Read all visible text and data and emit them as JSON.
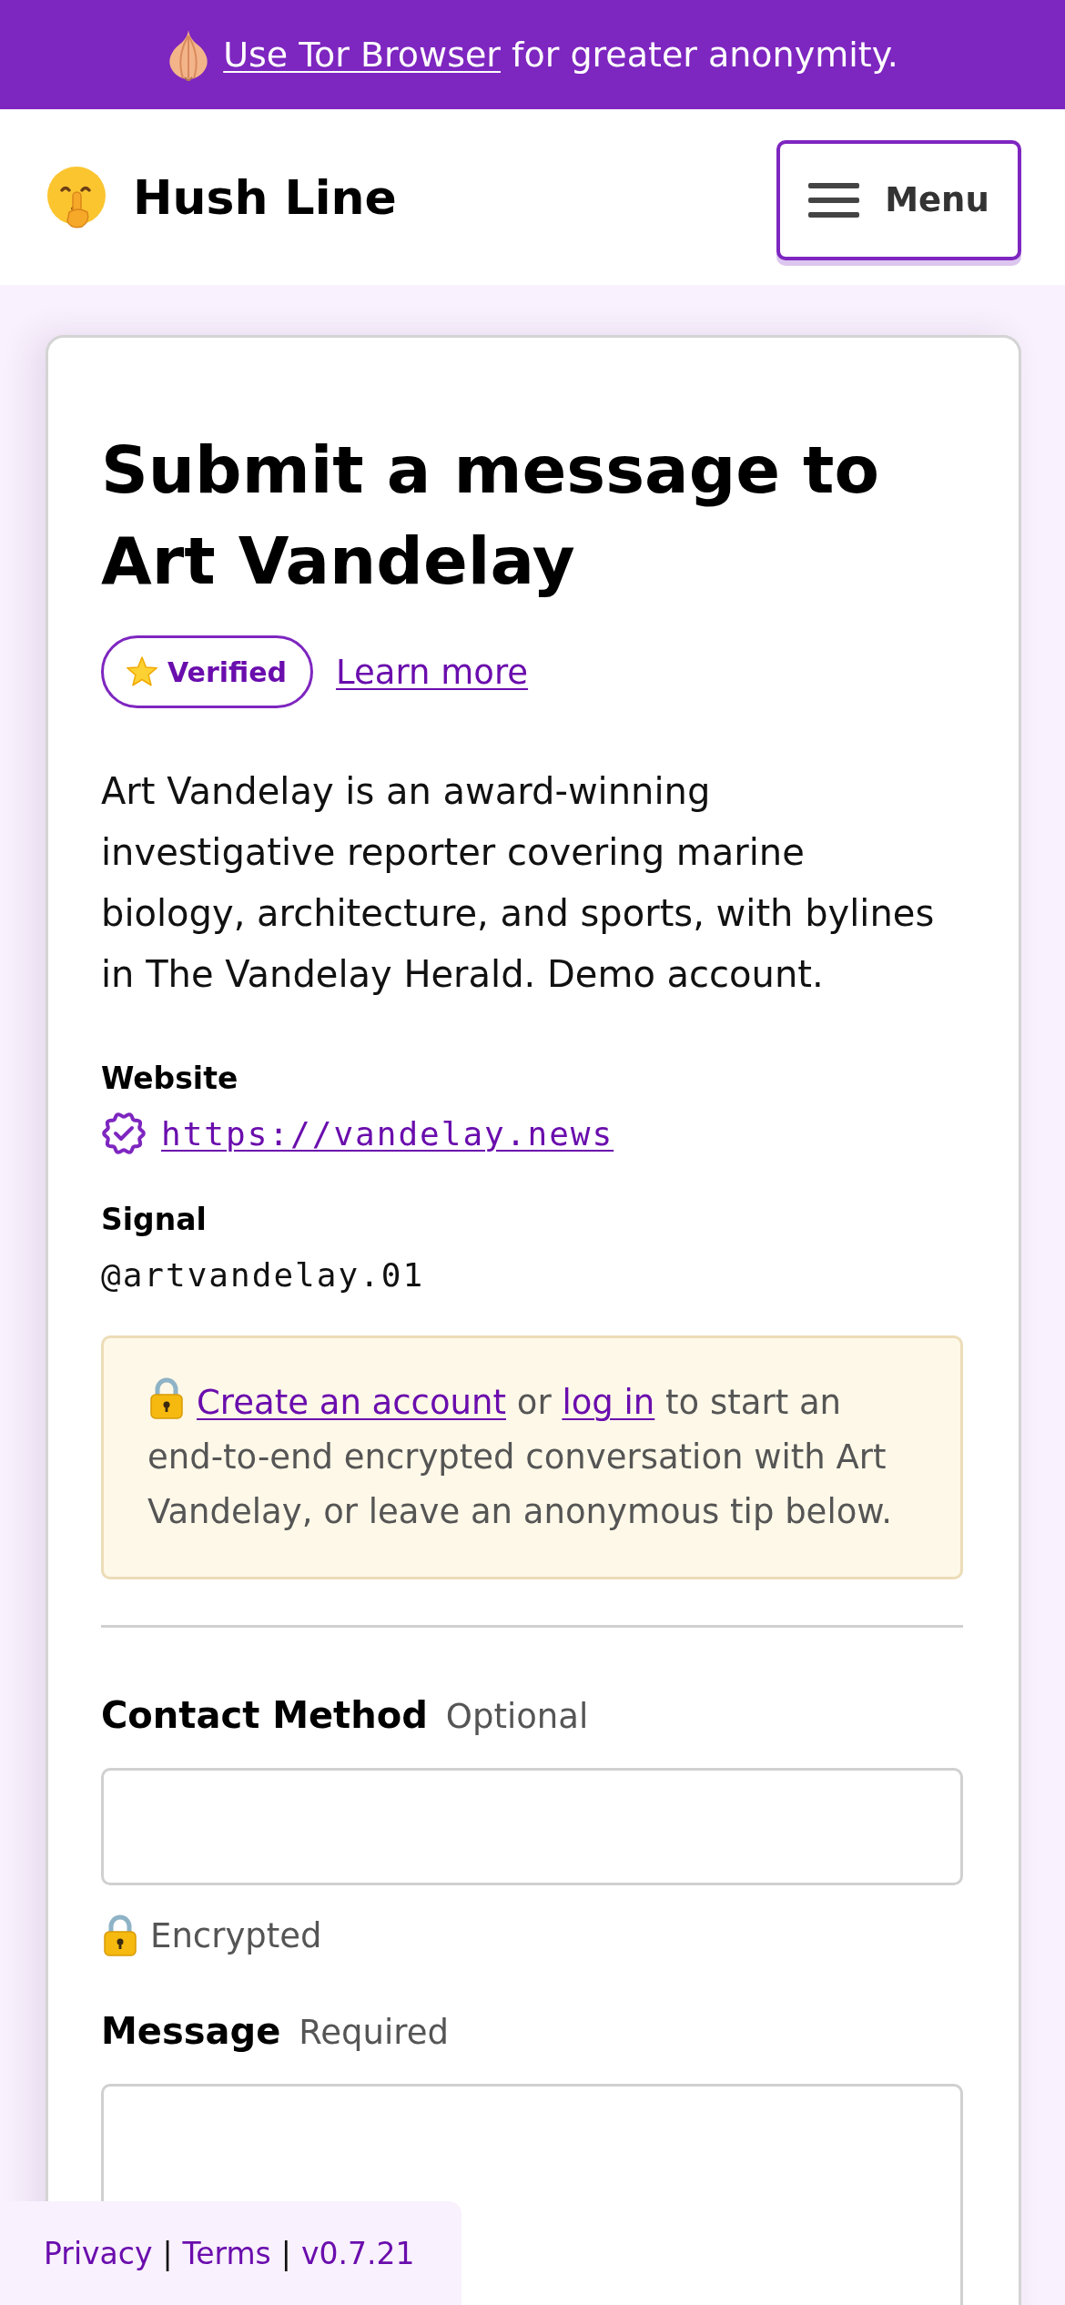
{
  "banner": {
    "link": "Use Tor Browser",
    "text": "for greater anonymity."
  },
  "header": {
    "site_name": "Hush Line",
    "menu_button": "Menu"
  },
  "profile": {
    "title": "Submit a message to Art Vandelay",
    "badge": {
      "label": "Verified"
    },
    "learn_more": "Learn more",
    "bio": "Art Vandelay is an award-winning investigative reporter covering marine biology, architecture, and sports, with bylines in The Vandelay Herald. Demo account.",
    "fields": [
      {
        "label": "Website",
        "kind": "link",
        "value": "https://vandelay.news",
        "verified": true
      },
      {
        "label": "Signal",
        "kind": "text",
        "value": "@artvandelay.01",
        "verified": false
      }
    ]
  },
  "notice": {
    "parts": [
      {
        "kind": "link",
        "text": "Create an account"
      },
      {
        "kind": "text",
        "text": "or"
      },
      {
        "kind": "link",
        "text": "log in"
      },
      {
        "kind": "text",
        "text": "to start an end-to-end encrypted conversation with Art Vandelay, or leave an anonymous tip below."
      }
    ]
  },
  "form": {
    "fields": [
      {
        "label": "Contact Method",
        "requirement": "Optional",
        "kind": "input",
        "note": "Encrypted"
      },
      {
        "label": "Message",
        "requirement": "Required",
        "kind": "textarea"
      }
    ]
  },
  "footer": {
    "items": [
      {
        "kind": "link",
        "text": "Privacy"
      },
      {
        "kind": "separator",
        "text": "|"
      },
      {
        "kind": "link",
        "text": "Terms"
      },
      {
        "kind": "separator",
        "text": "|"
      },
      {
        "kind": "link",
        "text": "v0.7.21"
      }
    ]
  }
}
